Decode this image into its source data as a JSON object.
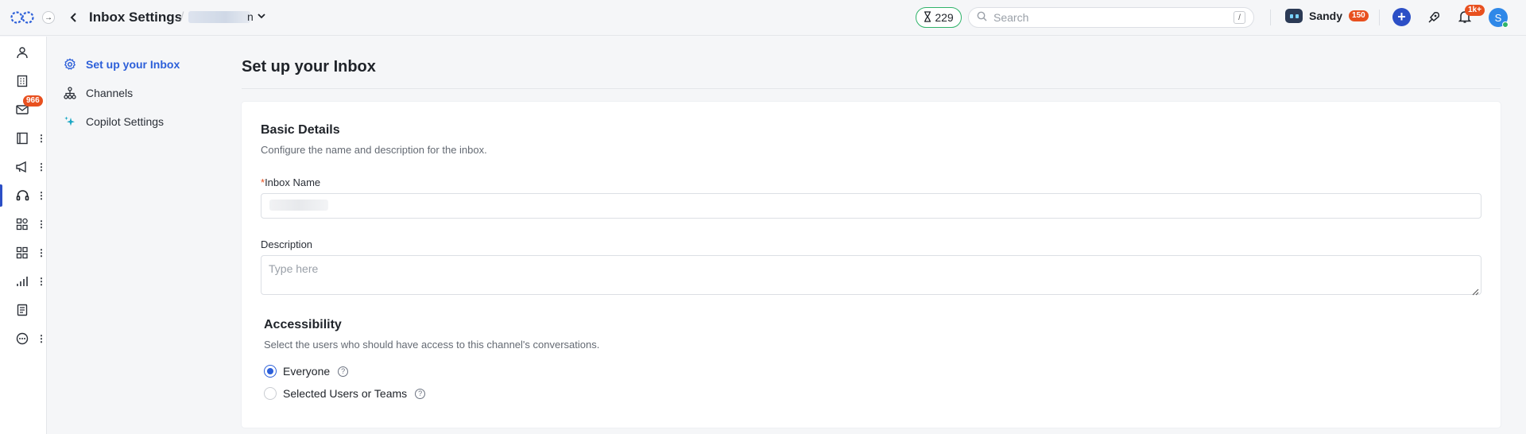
{
  "header": {
    "title": "Inbox Settings",
    "inbox_name_tail": "n",
    "timer_value": "229",
    "search_placeholder": "Search",
    "search_shortcut": "/",
    "user_name": "Sandy",
    "user_badge": "150",
    "notification_badge": "1k+",
    "avatar_initial": "S"
  },
  "rail": {
    "inbox_badge": "966"
  },
  "nav": {
    "items": [
      {
        "label": "Set up your Inbox",
        "icon": "gear-icon",
        "active": true
      },
      {
        "label": "Channels",
        "icon": "hierarchy-icon",
        "active": false
      },
      {
        "label": "Copilot Settings",
        "icon": "sparkle-icon",
        "active": false
      }
    ]
  },
  "main": {
    "title": "Set up your Inbox",
    "basic": {
      "title": "Basic Details",
      "description": "Configure the name and description for the inbox.",
      "name_required_mark": "*",
      "name_label": "Inbox Name",
      "description_label": "Description",
      "description_placeholder": "Type here"
    },
    "accessibility": {
      "title": "Accessibility",
      "description": "Select the users who should have access to this channel's conversations.",
      "options": [
        {
          "label": "Everyone",
          "selected": true
        },
        {
          "label": "Selected Users or Teams",
          "selected": false
        }
      ]
    }
  },
  "colors": {
    "accent": "#2c5fd9",
    "badge": "#e8501f",
    "timer_border": "#2fb36a"
  }
}
